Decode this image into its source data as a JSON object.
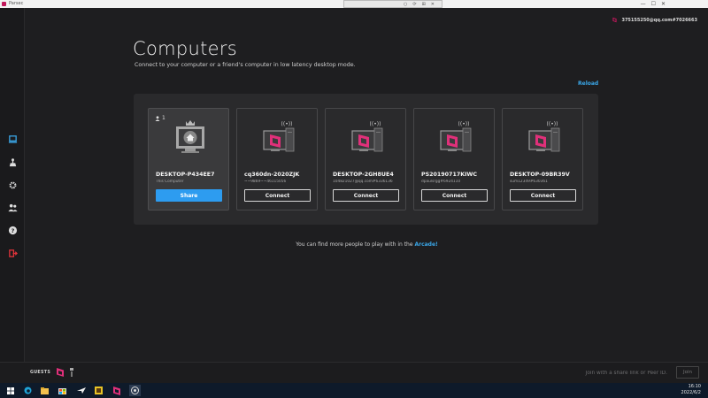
{
  "window": {
    "title": "Parsec",
    "controls": [
      "—",
      "☐",
      "✕"
    ],
    "mid_controls": [
      "○",
      "⟳",
      "⊞",
      "✕"
    ]
  },
  "account": {
    "label": "375155250@qq.com#7026663"
  },
  "page": {
    "title": "Computers",
    "subtitle": "Connect to your computer or a friend's computer in low latency desktop mode.",
    "reload_label": "Reload"
  },
  "computers": [
    {
      "name": "DESKTOP-P434EE7",
      "sub": "This Computer",
      "button": "Share",
      "guests": "1",
      "self": true
    },
    {
      "name": "cq360dn-2020ZJK",
      "sub": "~~9869~~46115056",
      "button": "Connect",
      "self": false
    },
    {
      "name": "DESKTOP-2GH8UE4",
      "sub": "104821027@qq.com#6336136",
      "button": "Connect",
      "self": false
    },
    {
      "name": "PS20190717KIWC",
      "sub": "dpaulsrgg#6924110",
      "button": "Connect",
      "self": false
    },
    {
      "name": "DESKTOP-09BR39V",
      "sub": "sum12349#630361",
      "button": "Connect",
      "self": false
    }
  ],
  "footer": {
    "text": "You can find more people to play with in the ",
    "link": "Arcade!"
  },
  "guests": {
    "label": "GUESTS",
    "peer_placeholder": "Join with a share link or Peer ID.",
    "join_label": "Join"
  },
  "taskbar": {
    "time": "16:10",
    "date": "2022/6/2"
  },
  "colors": {
    "accent": "#2d9cf0",
    "link": "#3aa7e8",
    "brand": "#c2185b",
    "logout": "#e0333a"
  }
}
